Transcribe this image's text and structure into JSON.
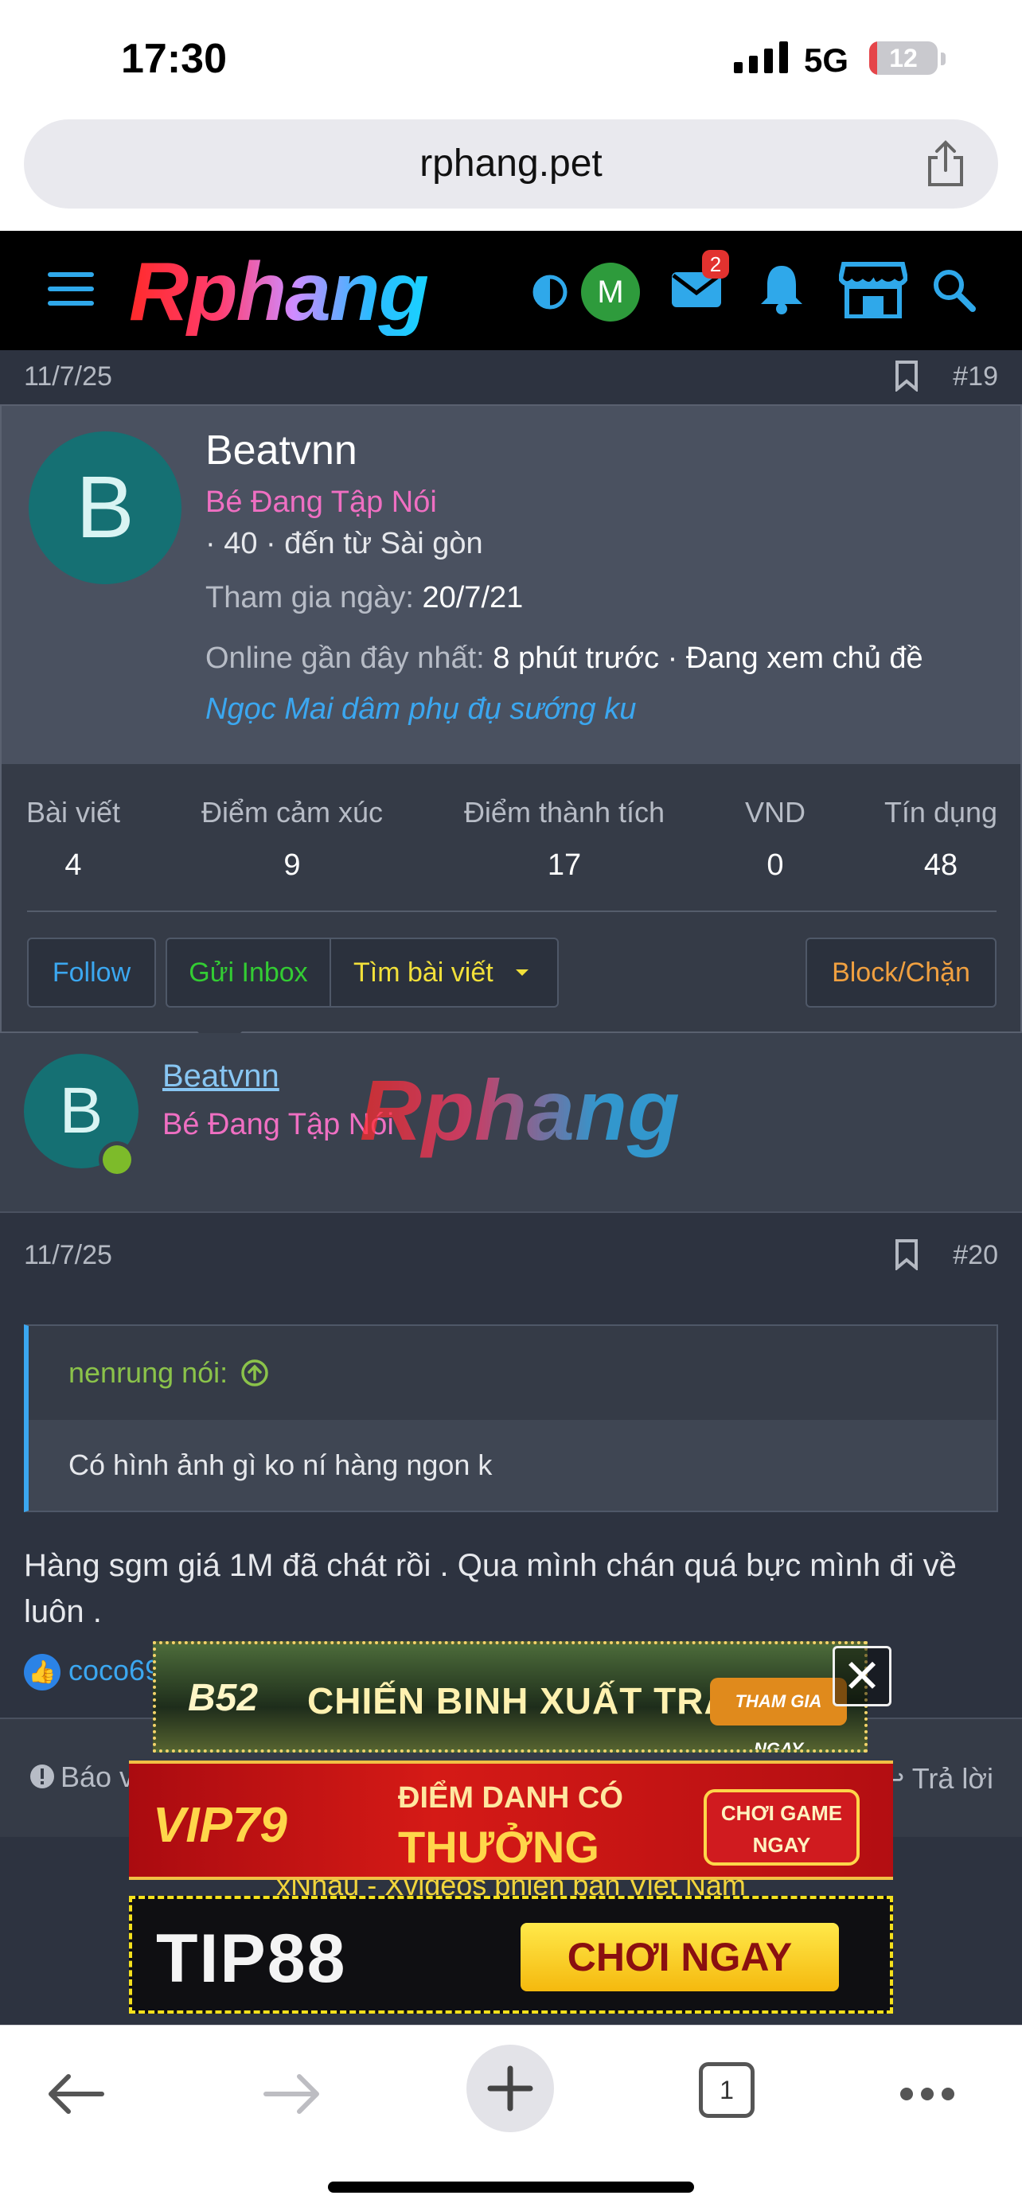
{
  "status_bar": {
    "time": "17:30",
    "network": "5G",
    "battery": "12",
    "battery_level_pct": 12
  },
  "browser": {
    "url": "rphang.pet",
    "tab_count": "1"
  },
  "site": {
    "logo": "Rphang",
    "avatar_initial": "M",
    "inbox_badge": "2"
  },
  "post19": {
    "date": "11/7/25",
    "number": "#19"
  },
  "member_card": {
    "avatar_initial": "B",
    "name": "Beatvnn",
    "rank": "Bé Đang Tập Nói",
    "location": "· 40 · đến từ Sài gòn",
    "joined_label": "Tham gia ngày:",
    "joined_value": "20/7/21",
    "online_label": "Online gần đây nhất:",
    "online_value": "8 phút trước · Đang xem chủ đề",
    "current_thread": "Ngọc Mai dâm phụ đụ sướng ku",
    "stats": [
      {
        "label": "Bài viết",
        "value": "4"
      },
      {
        "label": "Điểm cảm xúc",
        "value": "9"
      },
      {
        "label": "Điểm thành tích",
        "value": "17"
      },
      {
        "label": "VND",
        "value": "0"
      },
      {
        "label": "Tín dụng",
        "value": "48"
      }
    ],
    "buttons": {
      "follow": "Follow",
      "inbox": "Gửi Inbox",
      "find_posts": "Tìm bài viết",
      "block": "Block/Chặn"
    }
  },
  "author": {
    "avatar_initial": "B",
    "name": "Beatvnn",
    "rank": "Bé Đang Tập Nói",
    "watermark": "Rphang"
  },
  "post20": {
    "date": "11/7/25",
    "number": "#20",
    "quote_author": "nenrung nói:",
    "quote_text": "Có hình ảnh gì ko ní hàng ngon k",
    "body": "Hàng sgm giá 1M đã chát rồi . Qua mình chán quá bực mình đi về luôn .",
    "likers": "coco69",
    "report": "Báo vi",
    "reply": "Trả lời",
    "next_caption": "xNhau - Xvideos phiên bản Việt Nam"
  },
  "ads": {
    "ad1": {
      "logo": "B52",
      "title": "CHIẾN BINH XUẤT TRẬN",
      "cta": "THAM GIA NGAY"
    },
    "ad2": {
      "logo": "VIP79",
      "line1": "ĐIỂM DANH CÓ",
      "line2": "THƯỞNG",
      "cta": "CHƠI GAME NGAY"
    },
    "ad3": {
      "logo": "TIP88",
      "cta": "CHƠI NGAY"
    },
    "close": "✕"
  },
  "colors": {
    "accent_blue": "#3ba7f0",
    "rank_pink": "#ef6fc2",
    "online_green": "#7dbb2a",
    "inbox_green": "#33cc33",
    "find_yellow": "#f2e03a",
    "block_orange": "#f0a040"
  }
}
